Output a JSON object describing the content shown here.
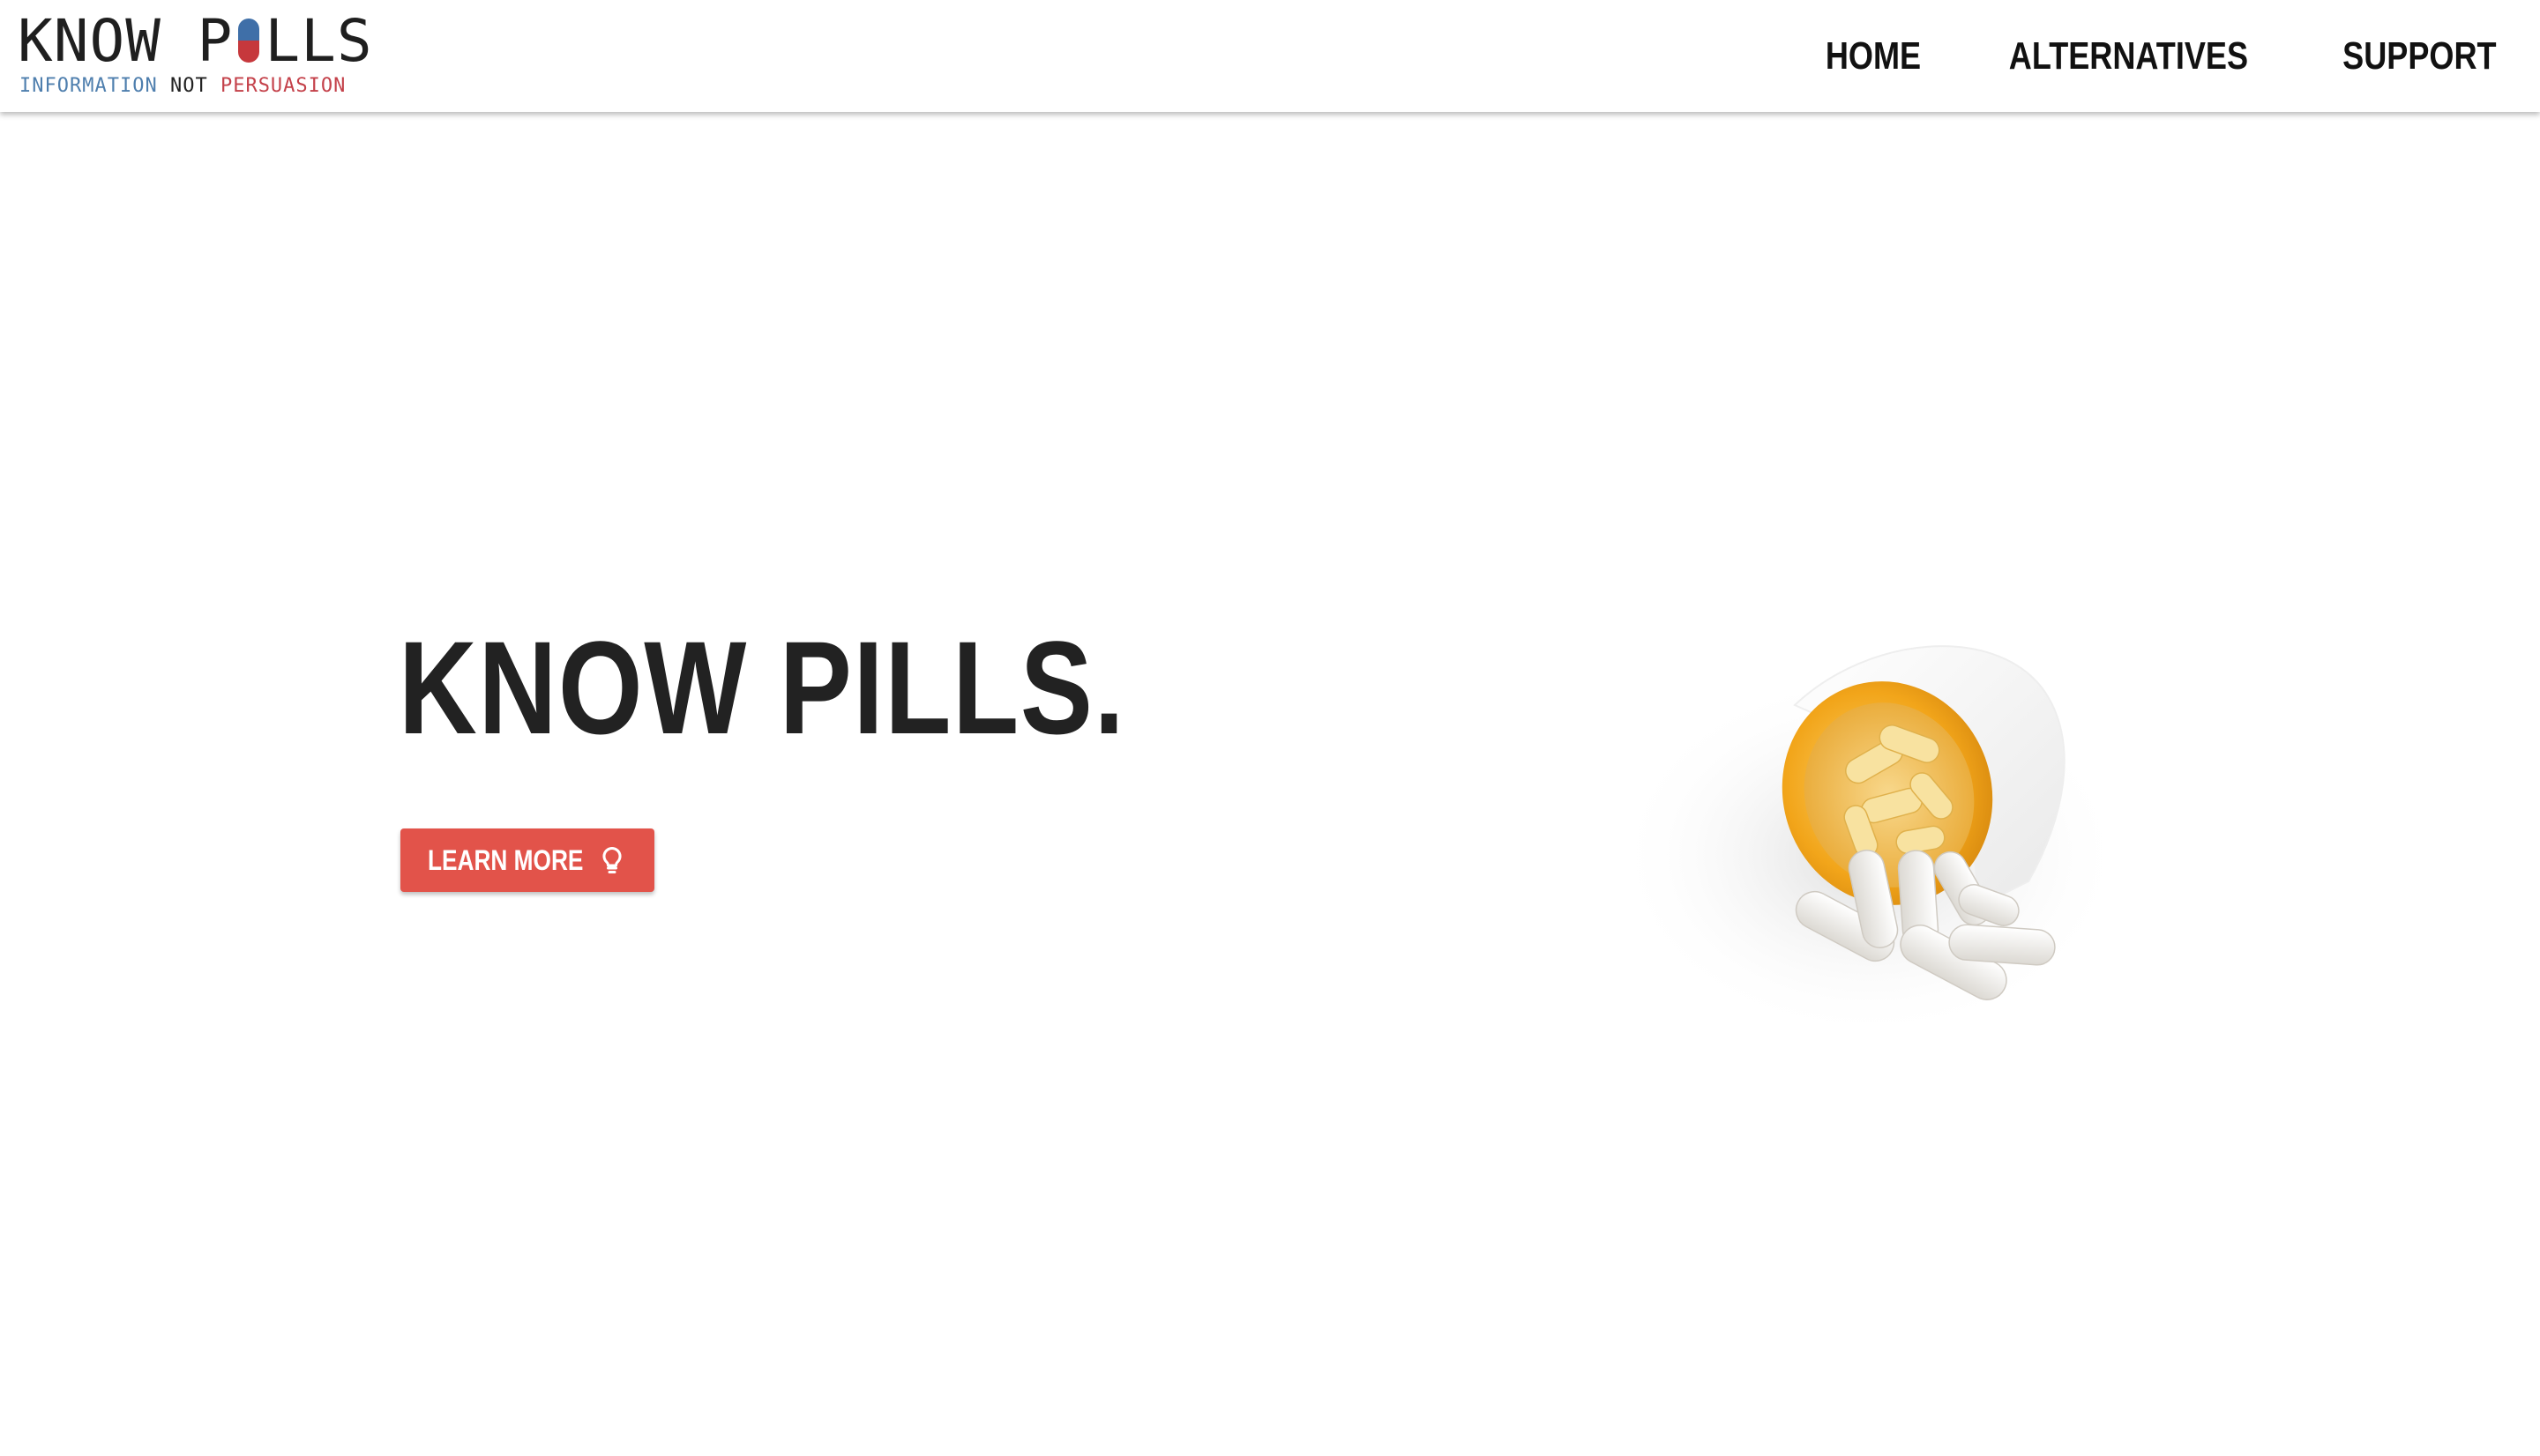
{
  "site": {
    "logo_title_left": "KNOW P",
    "logo_title_right": "LLS",
    "logo_tagline": {
      "part1": "INFORMATION",
      "part2": "NOT",
      "part3": "PERSUASION"
    }
  },
  "nav": {
    "items": [
      {
        "label": "HOME"
      },
      {
        "label": "ALTERNATIVES"
      },
      {
        "label": "SUPPORT"
      }
    ]
  },
  "hero": {
    "title": "KNOW PILLS.",
    "button_label": "LEARN MORE",
    "button_icon": "lightbulb-icon",
    "image": "pill-bottle-spilling-capsules"
  },
  "colors": {
    "accent": "#e2534a",
    "logo_blue": "#3f6fa8",
    "logo_red": "#c6383c",
    "text_dark": "#222222",
    "bottle_orange": "#f2a51a",
    "capsule_white": "#f4f2ee"
  }
}
